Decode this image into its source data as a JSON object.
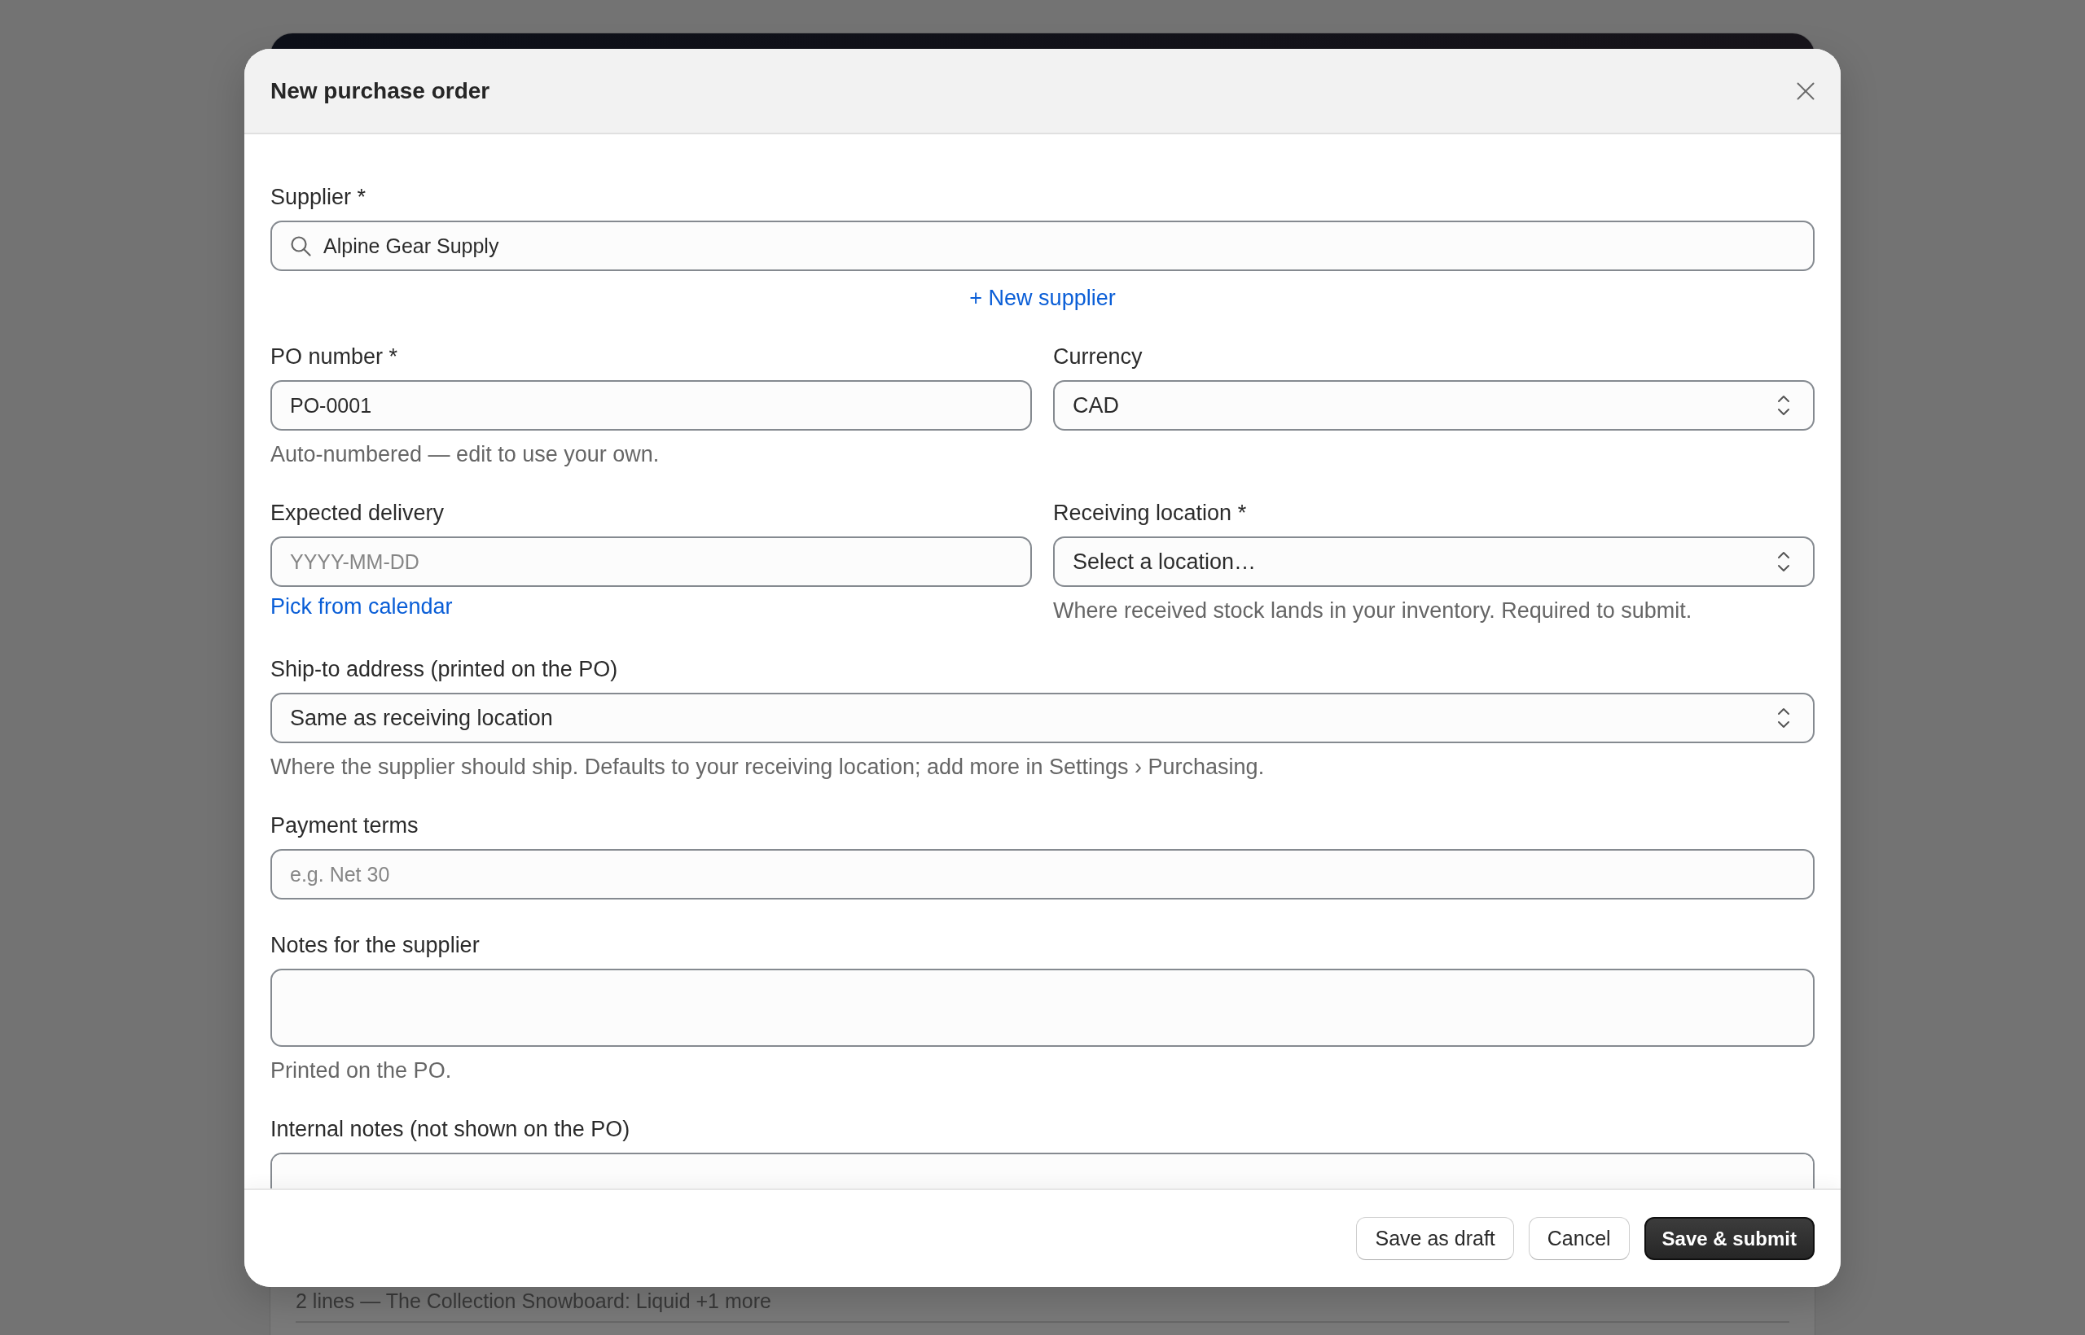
{
  "background_page": {
    "summary": "2 lines — The Collection Snowboard: Liquid +1 more"
  },
  "dialog": {
    "title": "New purchase order",
    "rows": [
      {
        "fields": [
          {
            "kind": "search",
            "label": "Supplier *",
            "value": "Alpine Gear Supply",
            "link": "+ New supplier"
          }
        ]
      },
      {
        "fields": [
          {
            "kind": "text",
            "label": "PO number *",
            "value": "PO-0001",
            "hint": "Auto-numbered — edit to use your own."
          },
          {
            "kind": "select",
            "label": "Currency",
            "value": "CAD"
          }
        ]
      },
      {
        "fields": [
          {
            "kind": "text",
            "label": "Expected delivery",
            "placeholder": "YYYY-MM-DD",
            "link": "Pick from calendar"
          },
          {
            "kind": "select",
            "label": "Receiving location *",
            "value": "Select a location…",
            "hint": "Where received stock lands in your inventory. Required to submit."
          }
        ]
      },
      {
        "fields": [
          {
            "kind": "select",
            "label": "Ship-to address (printed on the PO)",
            "value": "Same as receiving location",
            "hint": "Where the supplier should ship. Defaults to your receiving location; add more in Settings › Purchasing."
          }
        ]
      },
      {
        "fields": [
          {
            "kind": "text",
            "label": "Payment terms",
            "placeholder": "e.g. Net 30"
          }
        ]
      },
      {
        "fields": [
          {
            "kind": "textarea",
            "label": "Notes for the supplier",
            "hint": "Printed on the PO."
          }
        ]
      },
      {
        "fields": [
          {
            "kind": "textarea",
            "label": "Internal notes (not shown on the PO)"
          }
        ]
      }
    ],
    "buttons": [
      {
        "label": "Save as draft",
        "kind": "secondary"
      },
      {
        "label": "Cancel",
        "kind": "secondary"
      },
      {
        "label": "Save & submit",
        "kind": "primary"
      }
    ]
  }
}
